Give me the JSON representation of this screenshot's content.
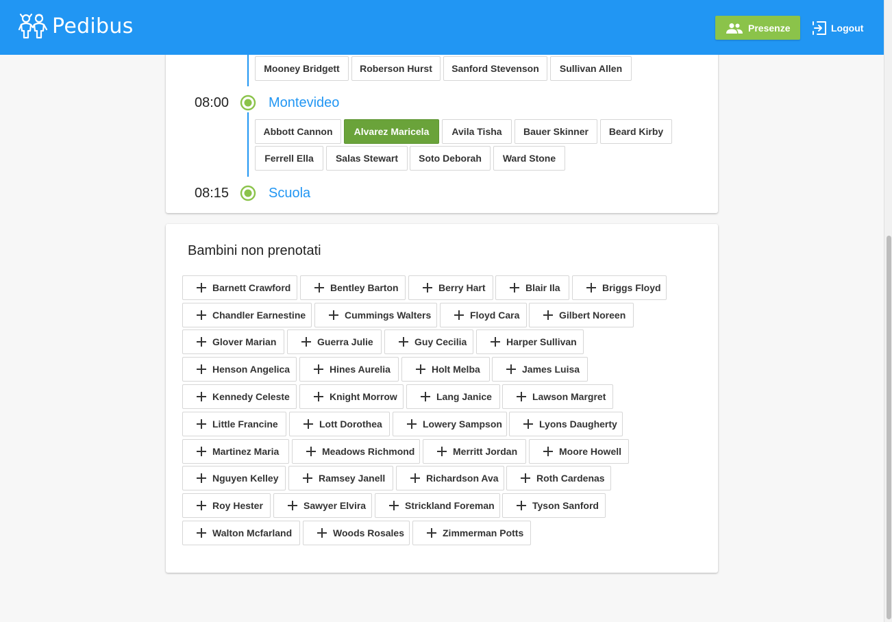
{
  "app": {
    "title": "Pedibus"
  },
  "toolbar": {
    "presenze_label": "Presenze",
    "logout_label": "Logout"
  },
  "stops": [
    {
      "time": "",
      "name": "",
      "children": [
        "Mooney Bridgett",
        "Roberson Hurst",
        "Sanford Stevenson",
        "Sullivan Allen"
      ]
    },
    {
      "time": "08:00",
      "name": "Montevideo",
      "children": [
        "Abbott Cannon",
        "Alvarez Maricela",
        "Avila Tisha",
        "Bauer Skinner",
        "Beard Kirby",
        "Ferrell Ella",
        "Salas Stewart",
        "Soto Deborah",
        "Ward Stone"
      ],
      "selected": "Alvarez Maricela"
    },
    {
      "time": "08:15",
      "name": "Scuola",
      "children": []
    }
  ],
  "unbooked": {
    "title": "Bambini non prenotati",
    "children": [
      "Barnett Crawford",
      "Bentley Barton",
      "Berry Hart",
      "Blair Ila",
      "Briggs Floyd",
      "Chandler Earnestine",
      "Cummings Walters",
      "Floyd Cara",
      "Gilbert Noreen",
      "Glover Marian",
      "Guerra Julie",
      "Guy Cecilia",
      "Harper Sullivan",
      "Henson Angelica",
      "Hines Aurelia",
      "Holt Melba",
      "James Luisa",
      "Kennedy Celeste",
      "Knight Morrow",
      "Lang Janice",
      "Lawson Margret",
      "Little Francine",
      "Lott Dorothea",
      "Lowery Sampson",
      "Lyons Daugherty",
      "Martinez Maria",
      "Meadows Richmond",
      "Merritt Jordan",
      "Moore Howell",
      "Nguyen Kelley",
      "Ramsey Janell",
      "Richardson Ava",
      "Roth Cardenas",
      "Roy Hester",
      "Sawyer Elvira",
      "Strickland Foreman",
      "Tyson Sanford",
      "Walton Mcfarland",
      "Woods Rosales",
      "Zimmerman Potts"
    ]
  },
  "colors": {
    "primary": "#2196f3",
    "accent": "#8bc34a",
    "selected": "#6aa33a"
  },
  "icons": {
    "logo": "children-logo-icon",
    "presenze": "people-icon",
    "logout": "logout-icon",
    "add": "plus-icon"
  }
}
